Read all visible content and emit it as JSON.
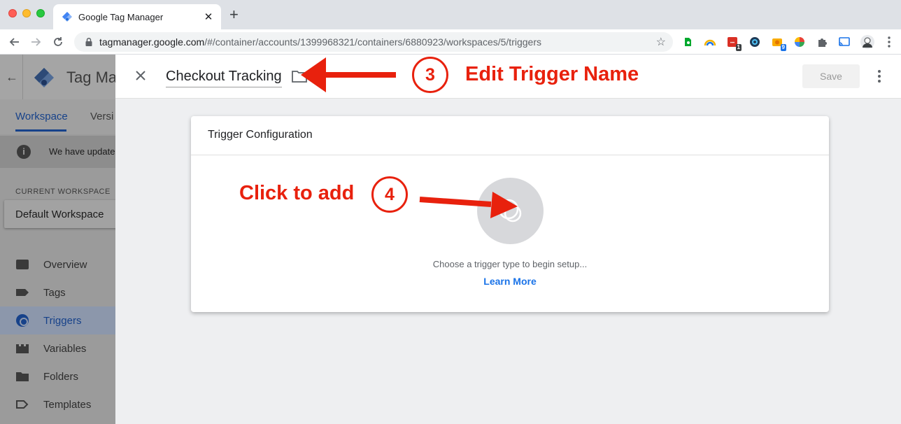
{
  "browser": {
    "tab_title": "Google Tag Manager",
    "tab_close": "✕",
    "new_tab": "+",
    "url_host": "tagmanager.google.com",
    "url_path": "/#/container/accounts/1399968321/containers/6880923/workspaces/5/triggers",
    "extensions": [
      {
        "name": "evernote-icon",
        "badge": ""
      },
      {
        "name": "rainbow-icon",
        "badge": ""
      },
      {
        "name": "calendar-ext-icon",
        "badge": "1"
      },
      {
        "name": "circle-ext-icon",
        "badge": ""
      },
      {
        "name": "folder-ext-icon",
        "badge": "9"
      },
      {
        "name": "color-wheel-icon",
        "badge": ""
      },
      {
        "name": "puzzle-icon",
        "badge": ""
      },
      {
        "name": "cast-icon",
        "badge": ""
      },
      {
        "name": "profile-avatar",
        "badge": ""
      }
    ]
  },
  "background_app": {
    "title": "Tag Man",
    "tabs": [
      "Workspace",
      "Versi"
    ],
    "notice": "We have update",
    "current_workspace_label": "CURRENT WORKSPACE",
    "workspace_name": "Default Workspace",
    "nav": [
      {
        "label": "Overview",
        "icon": "overview-icon",
        "active": false
      },
      {
        "label": "Tags",
        "icon": "tag-icon",
        "active": false
      },
      {
        "label": "Triggers",
        "icon": "trigger-icon",
        "active": true
      },
      {
        "label": "Variables",
        "icon": "variables-icon",
        "active": false
      },
      {
        "label": "Folders",
        "icon": "folder-icon",
        "active": false
      },
      {
        "label": "Templates",
        "icon": "templates-icon",
        "active": false
      }
    ]
  },
  "editor": {
    "trigger_name": "Checkout Tracking",
    "save_label": "Save",
    "card_title": "Trigger Configuration",
    "hint": "Choose a trigger type to begin setup...",
    "learn_more": "Learn More"
  },
  "annotations": {
    "step3_number": "3",
    "step3_text": "Edit Trigger Name",
    "step4_number": "4",
    "step4_text": "Click to add",
    "color": "#e8210d"
  }
}
